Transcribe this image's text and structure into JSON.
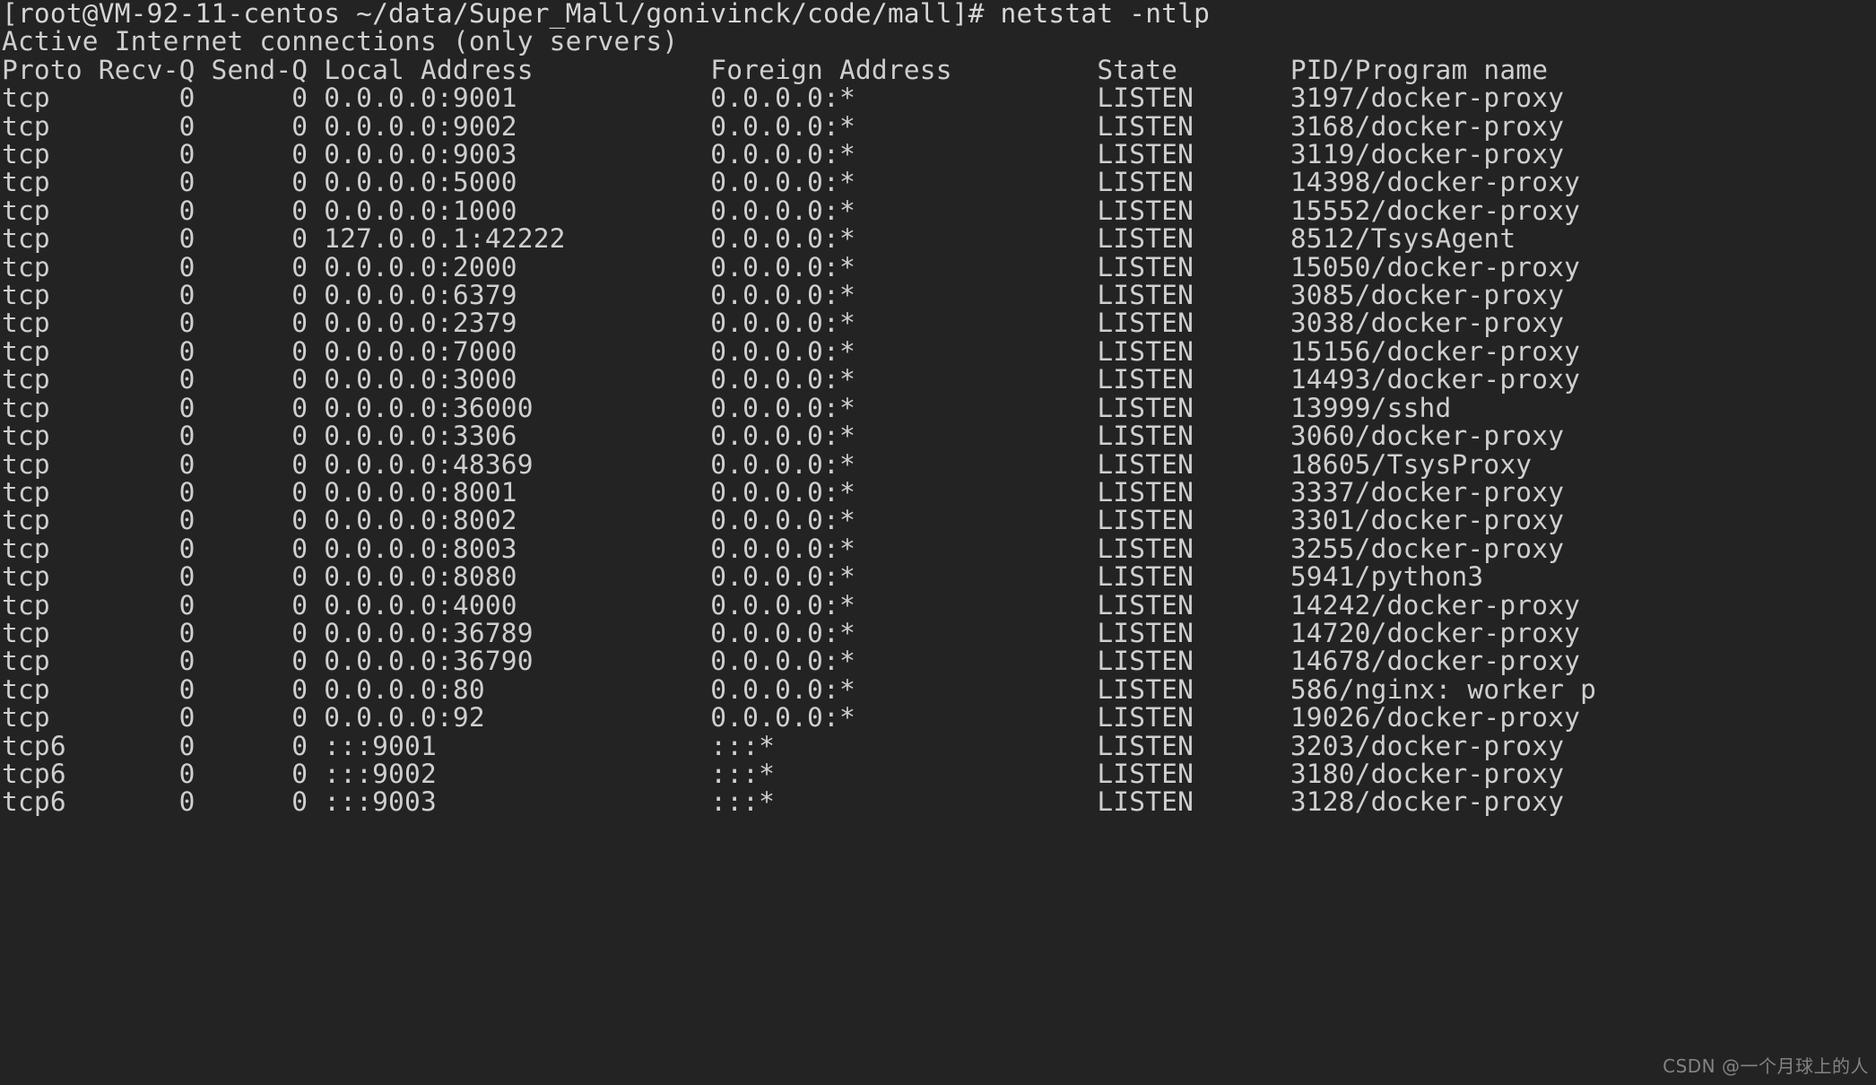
{
  "terminal": {
    "background_color": "#232323",
    "foreground_color": "#cfcfcf",
    "prompt": "[root@VM-92-11-centos ~/data/Super_Mall/gonivinck/code/mall]# netstat -ntlp",
    "title": "Active Internet connections (only servers)",
    "columns": {
      "proto": "Proto",
      "recvq": "Recv-Q",
      "sendq": "Send-Q",
      "local_address": "Local Address",
      "foreign_address": "Foreign Address",
      "state": "State",
      "pid_program": "PID/Program name"
    },
    "header_line": "Proto Recv-Q Send-Q Local Address           Foreign Address         State       PID/Program name",
    "rows": [
      {
        "proto": "tcp",
        "recvq": "0",
        "sendq": "0",
        "local": "0.0.0.0:9001",
        "foreign": "0.0.0.0:*",
        "state": "LISTEN",
        "pid": "3197/docker-proxy"
      },
      {
        "proto": "tcp",
        "recvq": "0",
        "sendq": "0",
        "local": "0.0.0.0:9002",
        "foreign": "0.0.0.0:*",
        "state": "LISTEN",
        "pid": "3168/docker-proxy"
      },
      {
        "proto": "tcp",
        "recvq": "0",
        "sendq": "0",
        "local": "0.0.0.0:9003",
        "foreign": "0.0.0.0:*",
        "state": "LISTEN",
        "pid": "3119/docker-proxy"
      },
      {
        "proto": "tcp",
        "recvq": "0",
        "sendq": "0",
        "local": "0.0.0.0:5000",
        "foreign": "0.0.0.0:*",
        "state": "LISTEN",
        "pid": "14398/docker-proxy"
      },
      {
        "proto": "tcp",
        "recvq": "0",
        "sendq": "0",
        "local": "0.0.0.0:1000",
        "foreign": "0.0.0.0:*",
        "state": "LISTEN",
        "pid": "15552/docker-proxy"
      },
      {
        "proto": "tcp",
        "recvq": "0",
        "sendq": "0",
        "local": "127.0.0.1:42222",
        "foreign": "0.0.0.0:*",
        "state": "LISTEN",
        "pid": "8512/TsysAgent"
      },
      {
        "proto": "tcp",
        "recvq": "0",
        "sendq": "0",
        "local": "0.0.0.0:2000",
        "foreign": "0.0.0.0:*",
        "state": "LISTEN",
        "pid": "15050/docker-proxy"
      },
      {
        "proto": "tcp",
        "recvq": "0",
        "sendq": "0",
        "local": "0.0.0.0:6379",
        "foreign": "0.0.0.0:*",
        "state": "LISTEN",
        "pid": "3085/docker-proxy"
      },
      {
        "proto": "tcp",
        "recvq": "0",
        "sendq": "0",
        "local": "0.0.0.0:2379",
        "foreign": "0.0.0.0:*",
        "state": "LISTEN",
        "pid": "3038/docker-proxy"
      },
      {
        "proto": "tcp",
        "recvq": "0",
        "sendq": "0",
        "local": "0.0.0.0:7000",
        "foreign": "0.0.0.0:*",
        "state": "LISTEN",
        "pid": "15156/docker-proxy"
      },
      {
        "proto": "tcp",
        "recvq": "0",
        "sendq": "0",
        "local": "0.0.0.0:3000",
        "foreign": "0.0.0.0:*",
        "state": "LISTEN",
        "pid": "14493/docker-proxy"
      },
      {
        "proto": "tcp",
        "recvq": "0",
        "sendq": "0",
        "local": "0.0.0.0:36000",
        "foreign": "0.0.0.0:*",
        "state": "LISTEN",
        "pid": "13999/sshd"
      },
      {
        "proto": "tcp",
        "recvq": "0",
        "sendq": "0",
        "local": "0.0.0.0:3306",
        "foreign": "0.0.0.0:*",
        "state": "LISTEN",
        "pid": "3060/docker-proxy"
      },
      {
        "proto": "tcp",
        "recvq": "0",
        "sendq": "0",
        "local": "0.0.0.0:48369",
        "foreign": "0.0.0.0:*",
        "state": "LISTEN",
        "pid": "18605/TsysProxy"
      },
      {
        "proto": "tcp",
        "recvq": "0",
        "sendq": "0",
        "local": "0.0.0.0:8001",
        "foreign": "0.0.0.0:*",
        "state": "LISTEN",
        "pid": "3337/docker-proxy"
      },
      {
        "proto": "tcp",
        "recvq": "0",
        "sendq": "0",
        "local": "0.0.0.0:8002",
        "foreign": "0.0.0.0:*",
        "state": "LISTEN",
        "pid": "3301/docker-proxy"
      },
      {
        "proto": "tcp",
        "recvq": "0",
        "sendq": "0",
        "local": "0.0.0.0:8003",
        "foreign": "0.0.0.0:*",
        "state": "LISTEN",
        "pid": "3255/docker-proxy"
      },
      {
        "proto": "tcp",
        "recvq": "0",
        "sendq": "0",
        "local": "0.0.0.0:8080",
        "foreign": "0.0.0.0:*",
        "state": "LISTEN",
        "pid": "5941/python3"
      },
      {
        "proto": "tcp",
        "recvq": "0",
        "sendq": "0",
        "local": "0.0.0.0:4000",
        "foreign": "0.0.0.0:*",
        "state": "LISTEN",
        "pid": "14242/docker-proxy"
      },
      {
        "proto": "tcp",
        "recvq": "0",
        "sendq": "0",
        "local": "0.0.0.0:36789",
        "foreign": "0.0.0.0:*",
        "state": "LISTEN",
        "pid": "14720/docker-proxy"
      },
      {
        "proto": "tcp",
        "recvq": "0",
        "sendq": "0",
        "local": "0.0.0.0:36790",
        "foreign": "0.0.0.0:*",
        "state": "LISTEN",
        "pid": "14678/docker-proxy"
      },
      {
        "proto": "tcp",
        "recvq": "0",
        "sendq": "0",
        "local": "0.0.0.0:80",
        "foreign": "0.0.0.0:*",
        "state": "LISTEN",
        "pid": "586/nginx: worker p"
      },
      {
        "proto": "tcp",
        "recvq": "0",
        "sendq": "0",
        "local": "0.0.0.0:92",
        "foreign": "0.0.0.0:*",
        "state": "LISTEN",
        "pid": "19026/docker-proxy"
      },
      {
        "proto": "tcp6",
        "recvq": "0",
        "sendq": "0",
        "local": ":::9001",
        "foreign": ":::*",
        "state": "LISTEN",
        "pid": "3203/docker-proxy"
      },
      {
        "proto": "tcp6",
        "recvq": "0",
        "sendq": "0",
        "local": ":::9002",
        "foreign": ":::*",
        "state": "LISTEN",
        "pid": "3180/docker-proxy"
      },
      {
        "proto": "tcp6",
        "recvq": "0",
        "sendq": "0",
        "local": ":::9003",
        "foreign": ":::*",
        "state": "LISTEN",
        "pid": "3128/docker-proxy"
      }
    ]
  },
  "watermark": {
    "text": "CSDN @一个月球上的人"
  }
}
